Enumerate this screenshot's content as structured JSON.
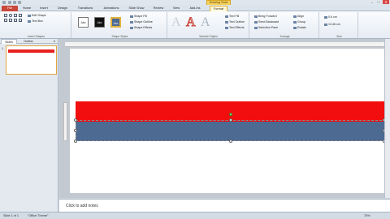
{
  "window": {
    "minimize": "–",
    "maximize": "□",
    "close": "✕"
  },
  "context_tab_group": "Drawing Tools",
  "tabs": [
    {
      "label": "File"
    },
    {
      "label": "Home"
    },
    {
      "label": "Insert"
    },
    {
      "label": "Design"
    },
    {
      "label": "Transitions"
    },
    {
      "label": "Animations"
    },
    {
      "label": "Slide Show"
    },
    {
      "label": "Review"
    },
    {
      "label": "View"
    },
    {
      "label": "Add-Ins"
    },
    {
      "label": "Format"
    }
  ],
  "ribbon": {
    "insert_shapes": {
      "edit_shape": "Edit Shape",
      "text_box": "Text Box",
      "label": "Insert Shapes"
    },
    "shape_styles": {
      "swatches": [
        "Abc",
        "Abc",
        "Abc"
      ],
      "fill": "Shape Fill",
      "outline": "Shape Outline",
      "effects": "Shape Effects",
      "label": "Shape Styles"
    },
    "wordart": {
      "letters": [
        "A",
        "A",
        "A"
      ],
      "text_fill": "Text Fill",
      "text_outline": "Text Outline",
      "text_effects": "Text Effects",
      "label": "WordArt Styles"
    },
    "arrange": {
      "bring_forward": "Bring Forward",
      "send_backward": "Send Backward",
      "selection_pane": "Selection Pane",
      "align": "Align",
      "group": "Group",
      "rotate": "Rotate",
      "label": "Arrange"
    },
    "size": {
      "height": "0.6 cm",
      "width": "13.46 cm",
      "label": "Size"
    }
  },
  "sidebar": {
    "tabs": [
      "Slides",
      "Outline"
    ],
    "close": "✕",
    "thumb_number": "1"
  },
  "notes": {
    "placeholder": "Click to add notes"
  },
  "status": {
    "slide": "Slide 1 of 1",
    "theme": "\"Office Theme\"",
    "zoom": "75%"
  }
}
